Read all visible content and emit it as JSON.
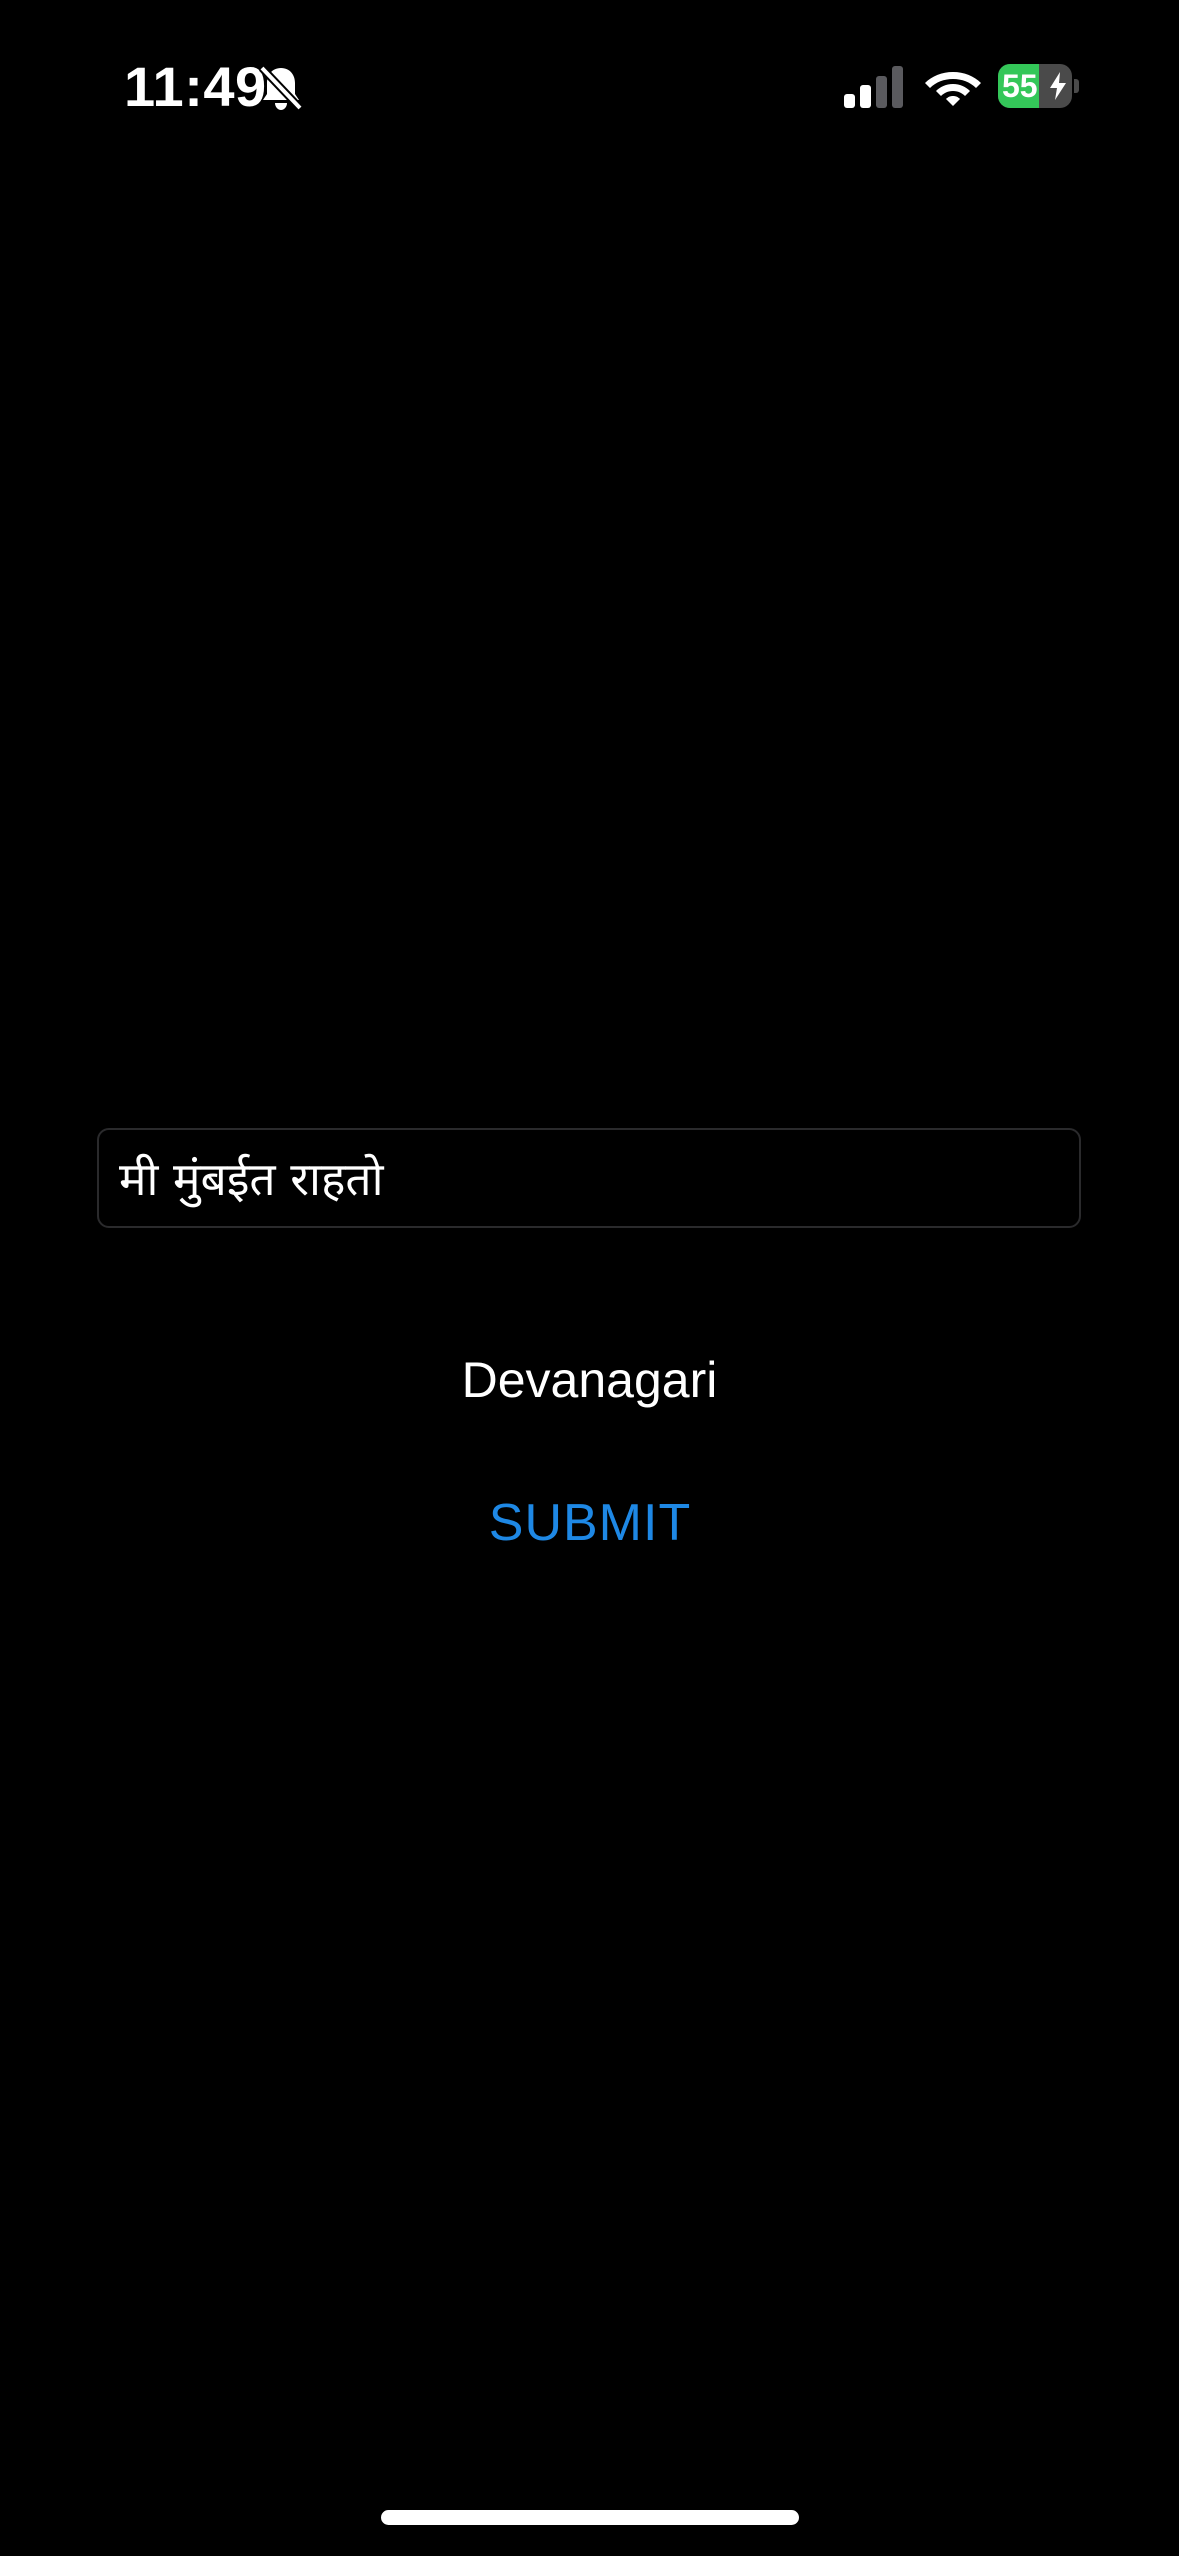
{
  "status_bar": {
    "time": "11:49",
    "battery_percent": "55",
    "battery_level": 0.55,
    "battery_color": "#34c759",
    "icons": [
      "bell-slash-icon",
      "cellular-signal-icon",
      "wifi-icon",
      "battery-icon",
      "charging-bolt-icon"
    ]
  },
  "form": {
    "input_value": "मी मुंबईत राहतो",
    "script_label": "Devanagari",
    "submit_label": "SUBMIT",
    "accent_color": "#1e88e5"
  }
}
